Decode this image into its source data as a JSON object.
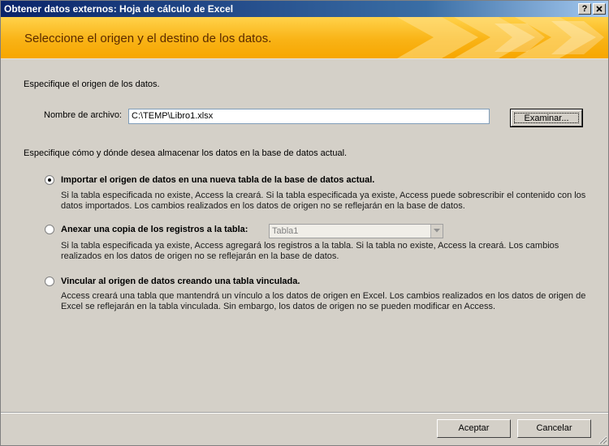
{
  "window": {
    "title": "Obtener datos externos: Hoja de cálculo de Excel",
    "help_button": "?",
    "close_button": "X"
  },
  "banner": {
    "title": "Seleccione el origen y el destino de los datos."
  },
  "source": {
    "instruction": "Especifique el origen de los datos.",
    "file_label": "Nombre de archivo:",
    "file_value": "C:\\TEMP\\Libro1.xlsx",
    "browse_button": "Examinar..."
  },
  "destination": {
    "instruction": "Especifique cómo y dónde desea almacenar los datos en la base de datos actual.",
    "options": [
      {
        "label": "Importar el origen de datos en una nueva tabla de la base de datos actual.",
        "selected": true,
        "description_1": "Si la tabla especificada no existe, Access la creará. Si la tabla especificada ya existe, Access puede sobrescribir el contenido con los",
        "description_2": "datos importados. Los cambios realizados en los datos de origen no se reflejarán en la base de datos."
      },
      {
        "label": "Anexar una copia de los registros a la tabla:",
        "selected": false,
        "table_value": "Tabla1",
        "description_1": "Si la tabla especificada ya existe, Access agregará los registros a la tabla. Si la tabla no existe, Access la creará. Los cambios",
        "description_2": "realizados en los datos de origen no se reflejarán en la base de datos."
      },
      {
        "label": "Vincular al origen de datos creando una tabla vinculada.",
        "selected": false,
        "description_1": "Access creará una tabla que mantendrá un vínculo a los datos de origen en Excel. Los cambios realizados en los datos de origen de",
        "description_2": "Excel se reflejarán en la tabla vinculada. Sin embargo, los datos de origen no se pueden modificar en Access."
      }
    ]
  },
  "footer": {
    "accept_button": "Aceptar",
    "cancel_button": "Cancelar"
  },
  "colors": {
    "banner_accent": "#f7a600",
    "titlebar": "#0a246a",
    "dialog_bg": "#d4d0c8"
  }
}
